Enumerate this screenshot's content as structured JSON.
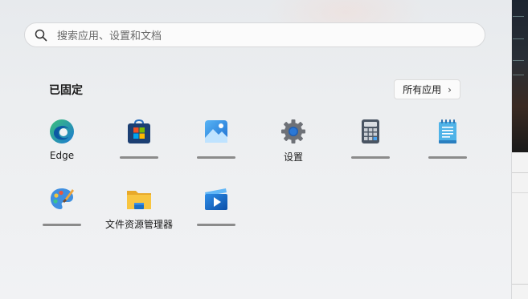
{
  "search": {
    "placeholder": "搜索应用、设置和文档"
  },
  "pinned": {
    "title": "已固定",
    "all_apps_label": "所有应用",
    "all_apps_chevron": "›"
  },
  "apps": [
    {
      "label": "Edge",
      "icon": "edge-icon"
    },
    {
      "label": "",
      "icon": "store-icon"
    },
    {
      "label": "",
      "icon": "photos-icon"
    },
    {
      "label": "设置",
      "icon": "settings-gear-icon"
    },
    {
      "label": "",
      "icon": "calculator-icon"
    },
    {
      "label": "",
      "icon": "notepad-icon"
    },
    {
      "label": "",
      "icon": "paint-palette-icon"
    },
    {
      "label": "文件资源管理器",
      "icon": "file-explorer-folder-icon"
    },
    {
      "label": "",
      "icon": "clipchamp-video-icon"
    }
  ],
  "colors": {
    "accent": "#0067c0",
    "edge_blue": "#1b78d4",
    "edge_green": "#3bc07a",
    "folder_yellow": "#f8c540"
  }
}
